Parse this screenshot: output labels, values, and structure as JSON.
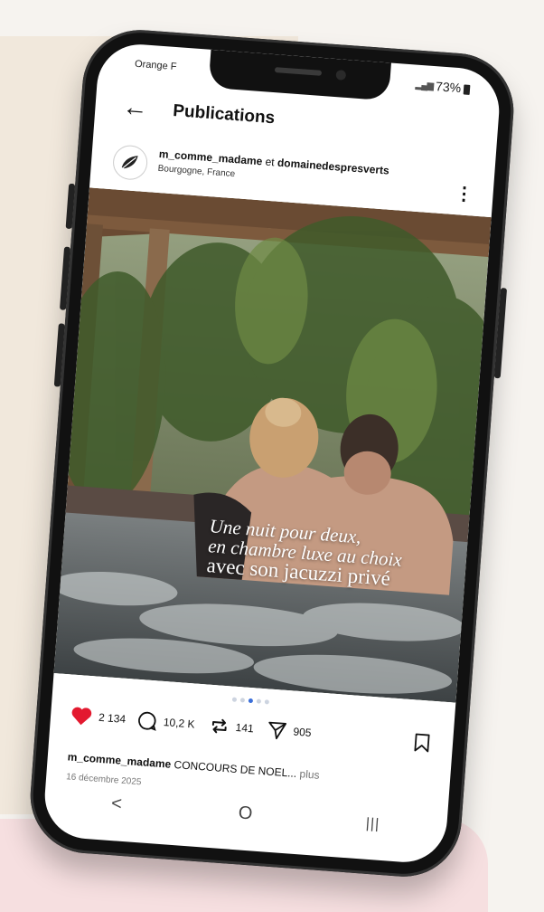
{
  "status": {
    "carrier": "Orange F",
    "battery": "73%"
  },
  "header": {
    "title": "Publications",
    "back_icon": "arrow-left-icon"
  },
  "post": {
    "author": "m_comme_madame",
    "connector": "et",
    "coauthor": "domainedespresverts",
    "location": "Bourgogne, France",
    "overlay_text": [
      "Une nuit pour deux,",
      "en chambre luxe au choix",
      "avec son jacuzzi privé"
    ],
    "carousel": {
      "count": 5,
      "active": 2
    }
  },
  "actions": {
    "likes": "2 134",
    "comments": "10,2 K",
    "reposts": "141",
    "shares": "905"
  },
  "caption": {
    "author": "m_comme_madame",
    "text": "CONCOURS DE NOEL...",
    "more": "plus",
    "date": "16 décembre 2025"
  },
  "navbar": {
    "back": "<",
    "home": "O",
    "recents": "|||"
  },
  "colors": {
    "like": "#e3192f",
    "accent": "#3b6fd9",
    "text": "#111111"
  }
}
